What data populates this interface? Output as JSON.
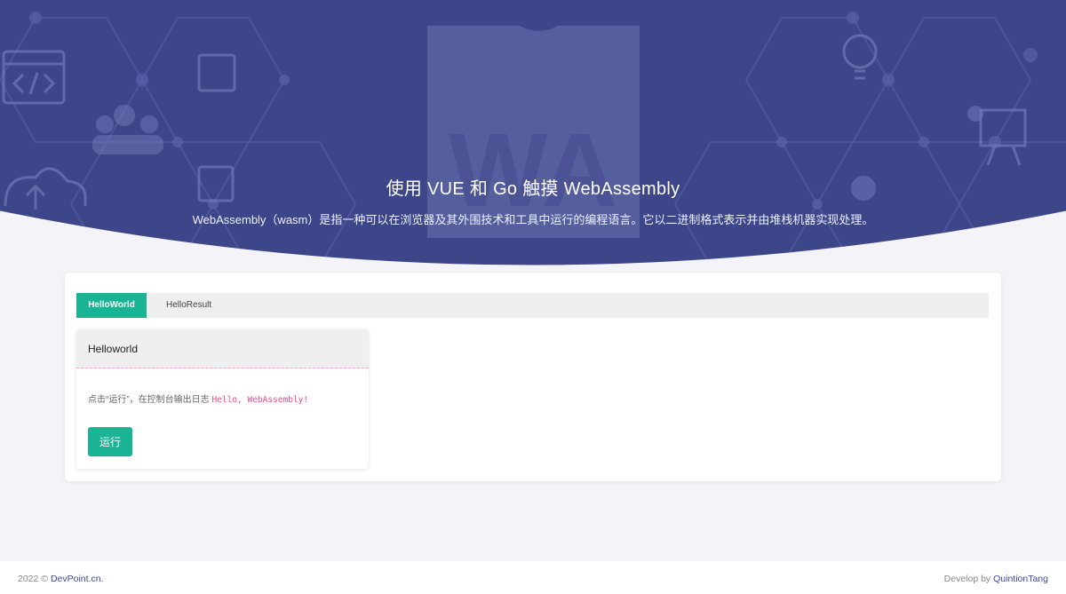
{
  "hero": {
    "title": "使用 VUE 和 Go 触摸 WebAssembly",
    "subtitle": "WebAssembly（wasm）是指一种可以在浏览器及其外围技术和工具中运行的编程语言。它以二进制格式表示并由堆栈机器实现处理。",
    "logo_text": "WA",
    "colors": {
      "background": "#3d4689",
      "accent": "#1ab394"
    }
  },
  "tabs": [
    {
      "label": "HelloWorld",
      "active": true
    },
    {
      "label": "HelloResult",
      "active": false
    }
  ],
  "panel": {
    "title": "Helloworld",
    "description": "点击“运行”，在控制台输出日志",
    "code": "Hello, WebAssembly!",
    "run_label": "运行"
  },
  "footer": {
    "year": "2022 ©",
    "site": "DevPoint.cn.",
    "develop_prefix": "Develop by",
    "developer": "QuintionTang"
  }
}
